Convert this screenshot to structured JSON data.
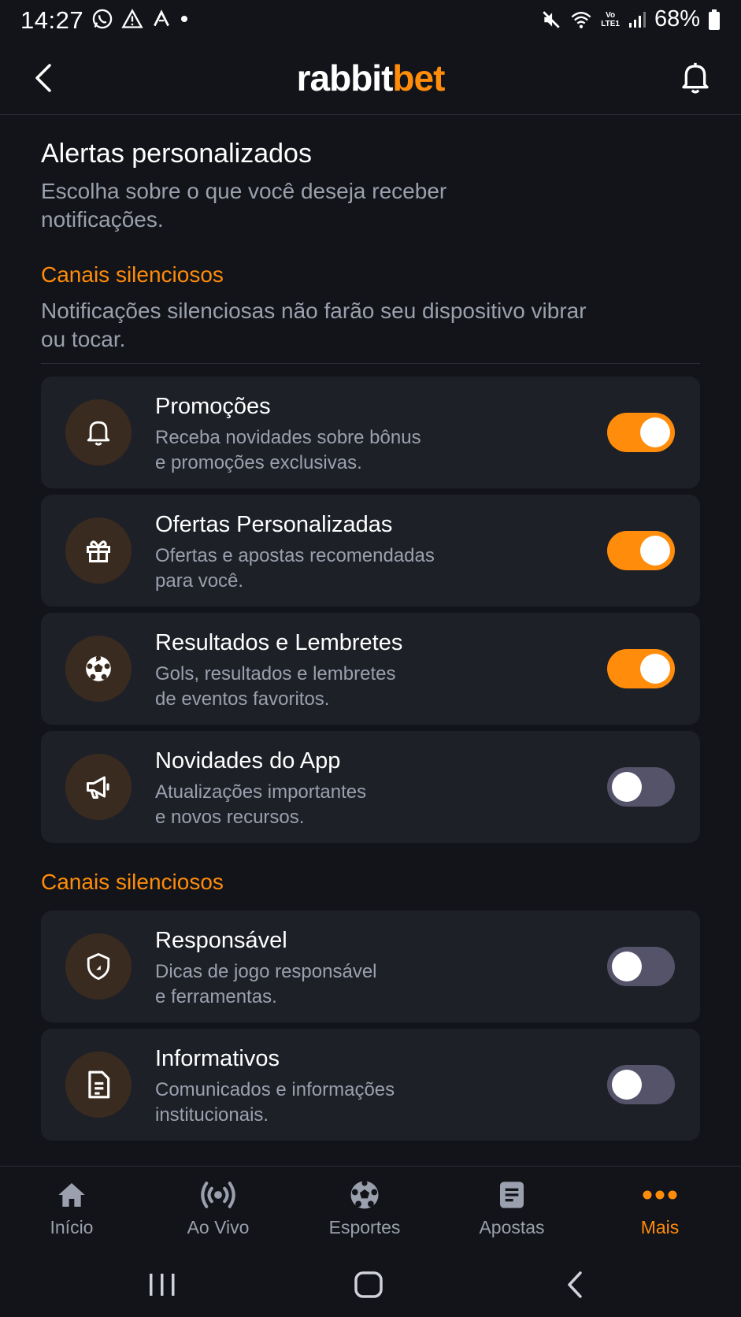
{
  "status_bar": {
    "time": "14:27",
    "battery": "68%",
    "lte_top": "Vo",
    "lte_bottom": "LTE1"
  },
  "header": {
    "logo_part1": "rabbit",
    "logo_part2": "bet",
    "brand_color": "#ff8c0a"
  },
  "page": {
    "title": "Alertas personalizados",
    "description": "Escolha sobre o que você deseja receber notificações."
  },
  "section1": {
    "title": "Canais silenciosos",
    "description": "Notificações silenciosas não farão seu dispositivo vibrar ou tocar.",
    "items": [
      {
        "icon": "bell-icon",
        "title": "Promoções",
        "desc_line1": "Receba novidades sobre bônus",
        "desc_line2": "e promoções exclusivas.",
        "enabled": true
      },
      {
        "icon": "gift-icon",
        "title": "Ofertas Personalizadas",
        "desc_line1": "Ofertas e apostas recomendadas",
        "desc_line2": "para você.",
        "enabled": true
      },
      {
        "icon": "soccer-ball-icon",
        "title": "Resultados e Lembretes",
        "desc_line1": "Gols, resultados e lembretes",
        "desc_line2": "de eventos favoritos.",
        "enabled": true
      },
      {
        "icon": "megaphone-icon",
        "title": "Novidades do App",
        "desc_line1": "Atualizações importantes",
        "desc_line2": "e novos recursos.",
        "enabled": false
      }
    ]
  },
  "section2": {
    "title": "Canais silenciosos",
    "items": [
      {
        "icon": "shield-icon",
        "title": "Responsável",
        "desc_line1": "Dicas de jogo responsável",
        "desc_line2": "e ferramentas.",
        "enabled": false
      },
      {
        "icon": "document-icon",
        "title": "Informativos",
        "desc_line1": "Comunicados e informações",
        "desc_line2": "institucionais.",
        "enabled": false
      }
    ]
  },
  "bottom_nav": {
    "items": [
      {
        "label": "Início",
        "icon": "home-icon"
      },
      {
        "label": "Ao Vivo",
        "icon": "live-broadcast-icon"
      },
      {
        "label": "Esportes",
        "icon": "soccer-ball-icon"
      },
      {
        "label": "Apostas",
        "icon": "bet-slip-icon"
      },
      {
        "label": "Mais",
        "icon": "more-dots-icon",
        "active": true
      }
    ]
  }
}
